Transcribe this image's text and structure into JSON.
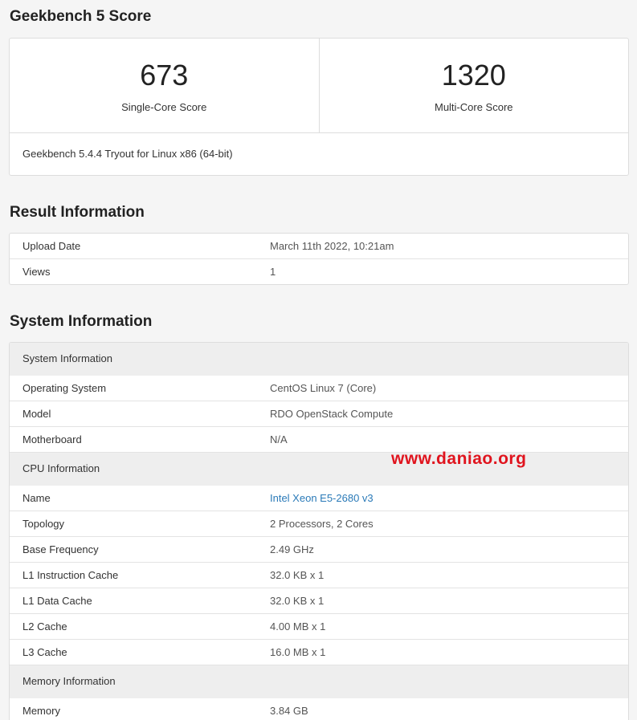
{
  "score_section": {
    "title": "Geekbench 5 Score",
    "single_core": {
      "value": "673",
      "label": "Single-Core Score"
    },
    "multi_core": {
      "value": "1320",
      "label": "Multi-Core Score"
    },
    "footer": "Geekbench 5.4.4 Tryout for Linux x86 (64-bit)"
  },
  "result_section": {
    "title": "Result Information",
    "rows": [
      {
        "key": "Upload Date",
        "value": "March 11th 2022, 10:21am"
      },
      {
        "key": "Views",
        "value": "1"
      }
    ]
  },
  "system_section": {
    "title": "System Information",
    "groups": [
      {
        "heading": "System Information",
        "rows": [
          {
            "key": "Operating System",
            "value": "CentOS Linux 7 (Core)"
          },
          {
            "key": "Model",
            "value": "RDO OpenStack Compute"
          },
          {
            "key": "Motherboard",
            "value": "N/A"
          }
        ]
      },
      {
        "heading": "CPU Information",
        "rows": [
          {
            "key": "Name",
            "value": "Intel Xeon E5-2680 v3"
          },
          {
            "key": "Topology",
            "value": "2 Processors, 2 Cores"
          },
          {
            "key": "Base Frequency",
            "value": "2.49 GHz"
          },
          {
            "key": "L1 Instruction Cache",
            "value": "32.0 KB x 1"
          },
          {
            "key": "L1 Data Cache",
            "value": "32.0 KB x 1"
          },
          {
            "key": "L2 Cache",
            "value": "4.00 MB x 1"
          },
          {
            "key": "L3 Cache",
            "value": "16.0 MB x 1"
          }
        ]
      },
      {
        "heading": "Memory Information",
        "rows": [
          {
            "key": "Memory",
            "value": "3.84 GB"
          }
        ]
      }
    ]
  },
  "watermark": "www.daniao.org",
  "colors": {
    "link": "#2a7ab8",
    "watermark": "#e0141e",
    "section_bg": "#eeeeee"
  }
}
